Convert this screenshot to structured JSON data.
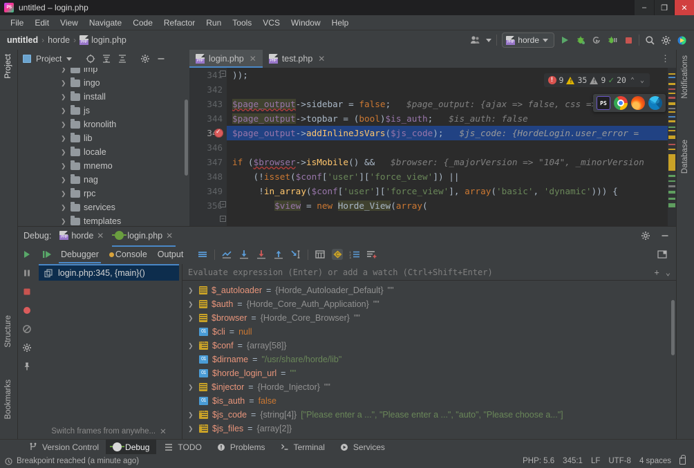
{
  "window": {
    "title": "untitled – login.php",
    "logo_icon": "phpstorm-logo-icon",
    "minimize": "–",
    "maximize": "❐",
    "close": "✕"
  },
  "menubar": {
    "items": [
      "File",
      "Edit",
      "View",
      "Navigate",
      "Code",
      "Refactor",
      "Run",
      "Tools",
      "VCS",
      "Window",
      "Help"
    ]
  },
  "navbar": {
    "crumbs": [
      "untitled",
      "horde",
      "login.php"
    ],
    "separator": "›",
    "run_config": "horde",
    "icons": [
      "user-avatar-icon",
      "run-icon",
      "debug-icon",
      "rerun-icon",
      "attach-debugger-icon",
      "stop-icon",
      "search-icon",
      "settings-gear-icon",
      "updates-icon"
    ]
  },
  "project_panel": {
    "title": "Project",
    "toolbar_icons": [
      "locate-icon",
      "expand-all-icon",
      "collapse-all-icon",
      "settings-gear-icon",
      "hide-icon"
    ],
    "tree": [
      {
        "label": "imp"
      },
      {
        "label": "ingo"
      },
      {
        "label": "install"
      },
      {
        "label": "js"
      },
      {
        "label": "kronolith"
      },
      {
        "label": "lib"
      },
      {
        "label": "locale"
      },
      {
        "label": "mnemo"
      },
      {
        "label": "nag"
      },
      {
        "label": "rpc"
      },
      {
        "label": "services"
      },
      {
        "label": "templates"
      }
    ]
  },
  "left_stripe": {
    "top_tab": "Project",
    "bottom_tabs": [
      "Structure",
      "Bookmarks"
    ]
  },
  "right_stripe": {
    "tabs": [
      "Notifications",
      "Database"
    ]
  },
  "editor": {
    "tabs": [
      {
        "label": "login.php",
        "active": true
      },
      {
        "label": "test.php",
        "active": false
      }
    ],
    "inspections": {
      "errors": "9",
      "warnings": "35",
      "weak_warnings": "9",
      "typos": "20",
      "up": "⌃",
      "down": "⌄"
    },
    "lines": [
      {
        "num": "341",
        "fold": true,
        "text": "));"
      },
      {
        "num": "342",
        "text": ""
      },
      {
        "num": "343",
        "text": "$page_output->sidebar = false;",
        "hint": "$page_output: {ajax => false, css => Horde_T"
      },
      {
        "num": "344",
        "text": "$page_output->topbar = (bool)$is_auth;",
        "hint": "$is_auth: false"
      },
      {
        "num": "345",
        "text": "$page_output->addInlineJsVars($js_code);",
        "hint": "$js_code: {HordeLogin.user_error =",
        "breakpoint": true,
        "selected": true
      },
      {
        "num": "346",
        "text": ""
      },
      {
        "num": "347",
        "text": "if ($browser->isMobile() &&",
        "hint": "$browser: {_majorVersion => \"104\", _minorVersion"
      },
      {
        "num": "348",
        "text": "    (!isset($conf['user']['force_view']) ||"
      },
      {
        "num": "349",
        "text": "     !in_array($conf['user']['force_view'], array('basic', 'dynamic')))) {",
        "fold": true
      },
      {
        "num": "350",
        "text": "        $view = new Horde_View(array("
      }
    ],
    "browser_popup": {
      "icons": [
        "phpstorm-icon",
        "chrome-icon",
        "firefox-icon",
        "edge-icon"
      ],
      "phpstorm_label": "PS"
    }
  },
  "debug": {
    "header_label": "Debug:",
    "tabs": [
      {
        "label": "horde",
        "icon": "php-config-icon",
        "active": false
      },
      {
        "label": "login.php",
        "icon": "debug-bug-icon",
        "active": true
      }
    ],
    "header_icons": [
      "settings-gear-icon",
      "hide-icon"
    ],
    "toolbar": {
      "resume_icon": "resume-program-icon",
      "tabs": [
        "Debugger",
        "Console",
        "Output"
      ],
      "active_tab": "Debugger",
      "icons": [
        "show-execution-point-icon",
        "step-over-icon",
        "step-into-icon",
        "force-step-into-icon",
        "step-out-icon",
        "run-to-cursor-icon",
        "evaluate-expression-icon",
        "mute-breakpoints-icon",
        "settings-list-icon",
        "add-watch-icon"
      ],
      "layout_icon": "restore-layout-icon"
    },
    "side_icons": [
      "rerun-icon",
      "pause-icon",
      "stop-icon",
      "view-breakpoints-icon",
      "mute-breakpoints-icon",
      "settings-gear-icon",
      "pin-icon"
    ],
    "frames": {
      "current": "login.php:345, {main}()",
      "footer_hint": "Switch frames from anywhe...",
      "footer_close": "✕"
    },
    "evaluate_placeholder": "Evaluate expression (Enter) or add a watch (Ctrl+Shift+Enter)",
    "evaluate_icons": [
      "add-icon",
      "chevron-down-icon"
    ],
    "variables": [
      {
        "expandable": true,
        "icon": "object-icon",
        "name": "$_autoloader",
        "value_type": "{Horde_Autoloader_Default}",
        "value_extra": "\"\"",
        "kind": "obj"
      },
      {
        "expandable": true,
        "icon": "object-icon",
        "name": "$auth",
        "value_type": "{Horde_Core_Auth_Application}",
        "value_extra": "\"\"",
        "kind": "obj"
      },
      {
        "expandable": true,
        "icon": "object-icon",
        "name": "$browser",
        "value_type": "{Horde_Core_Browser}",
        "value_extra": "\"\"",
        "kind": "obj"
      },
      {
        "expandable": false,
        "icon": "primitive-icon",
        "name": "$cli",
        "value_null": "null",
        "kind": "null"
      },
      {
        "expandable": true,
        "icon": "array-icon",
        "name": "$conf",
        "value_type": "{array[58]}",
        "kind": "arr"
      },
      {
        "expandable": false,
        "icon": "primitive-icon",
        "name": "$dirname",
        "value_str": "\"/usr/share/horde/lib\"",
        "kind": "str"
      },
      {
        "expandable": false,
        "icon": "primitive-icon",
        "name": "$horde_login_url",
        "value_str": "\"\"",
        "kind": "str"
      },
      {
        "expandable": true,
        "icon": "object-icon",
        "name": "$injector",
        "value_type": "{Horde_Injector}",
        "value_extra": "\"\"",
        "kind": "obj"
      },
      {
        "expandable": false,
        "icon": "primitive-icon",
        "name": "$is_auth",
        "value_kw": "false",
        "kind": "kw"
      },
      {
        "expandable": true,
        "icon": "array-icon",
        "name": "$js_code",
        "value_type": "{string[4]}",
        "value_str": "[\"Please enter a ...\", \"Please enter a ...\", \"auto\", \"Please choose a...\"]",
        "kind": "arrstr"
      },
      {
        "expandable": true,
        "icon": "array-icon",
        "name": "$js_files",
        "value_type": "{array[2]}",
        "kind": "arr"
      }
    ]
  },
  "bottom_bar": {
    "items": [
      {
        "label": "Version Control",
        "icon": "branch-icon",
        "active": false
      },
      {
        "label": "Debug",
        "icon": "debug-bug-icon",
        "active": true
      },
      {
        "label": "TODO",
        "icon": "todo-list-icon",
        "active": false
      },
      {
        "label": "Problems",
        "icon": "problems-icon",
        "active": false
      },
      {
        "label": "Terminal",
        "icon": "terminal-icon",
        "active": false
      },
      {
        "label": "Services",
        "icon": "services-icon",
        "active": false
      }
    ]
  },
  "status_bar": {
    "message": "Breakpoint reached (a minute ago)",
    "php_version": "PHP: 5.6",
    "caret": "345:1",
    "line_separator": "LF",
    "encoding": "UTF-8",
    "indent": "4 spaces",
    "lock_icon": "lock-icon"
  },
  "colors": {
    "accent": "#4a88c7",
    "selection": "#214283",
    "error": "#d9534f",
    "warning": "#e0b400",
    "ok": "#4f9e4f",
    "editor_bg": "#2b2b2b",
    "panel_bg": "#3c3f41"
  }
}
